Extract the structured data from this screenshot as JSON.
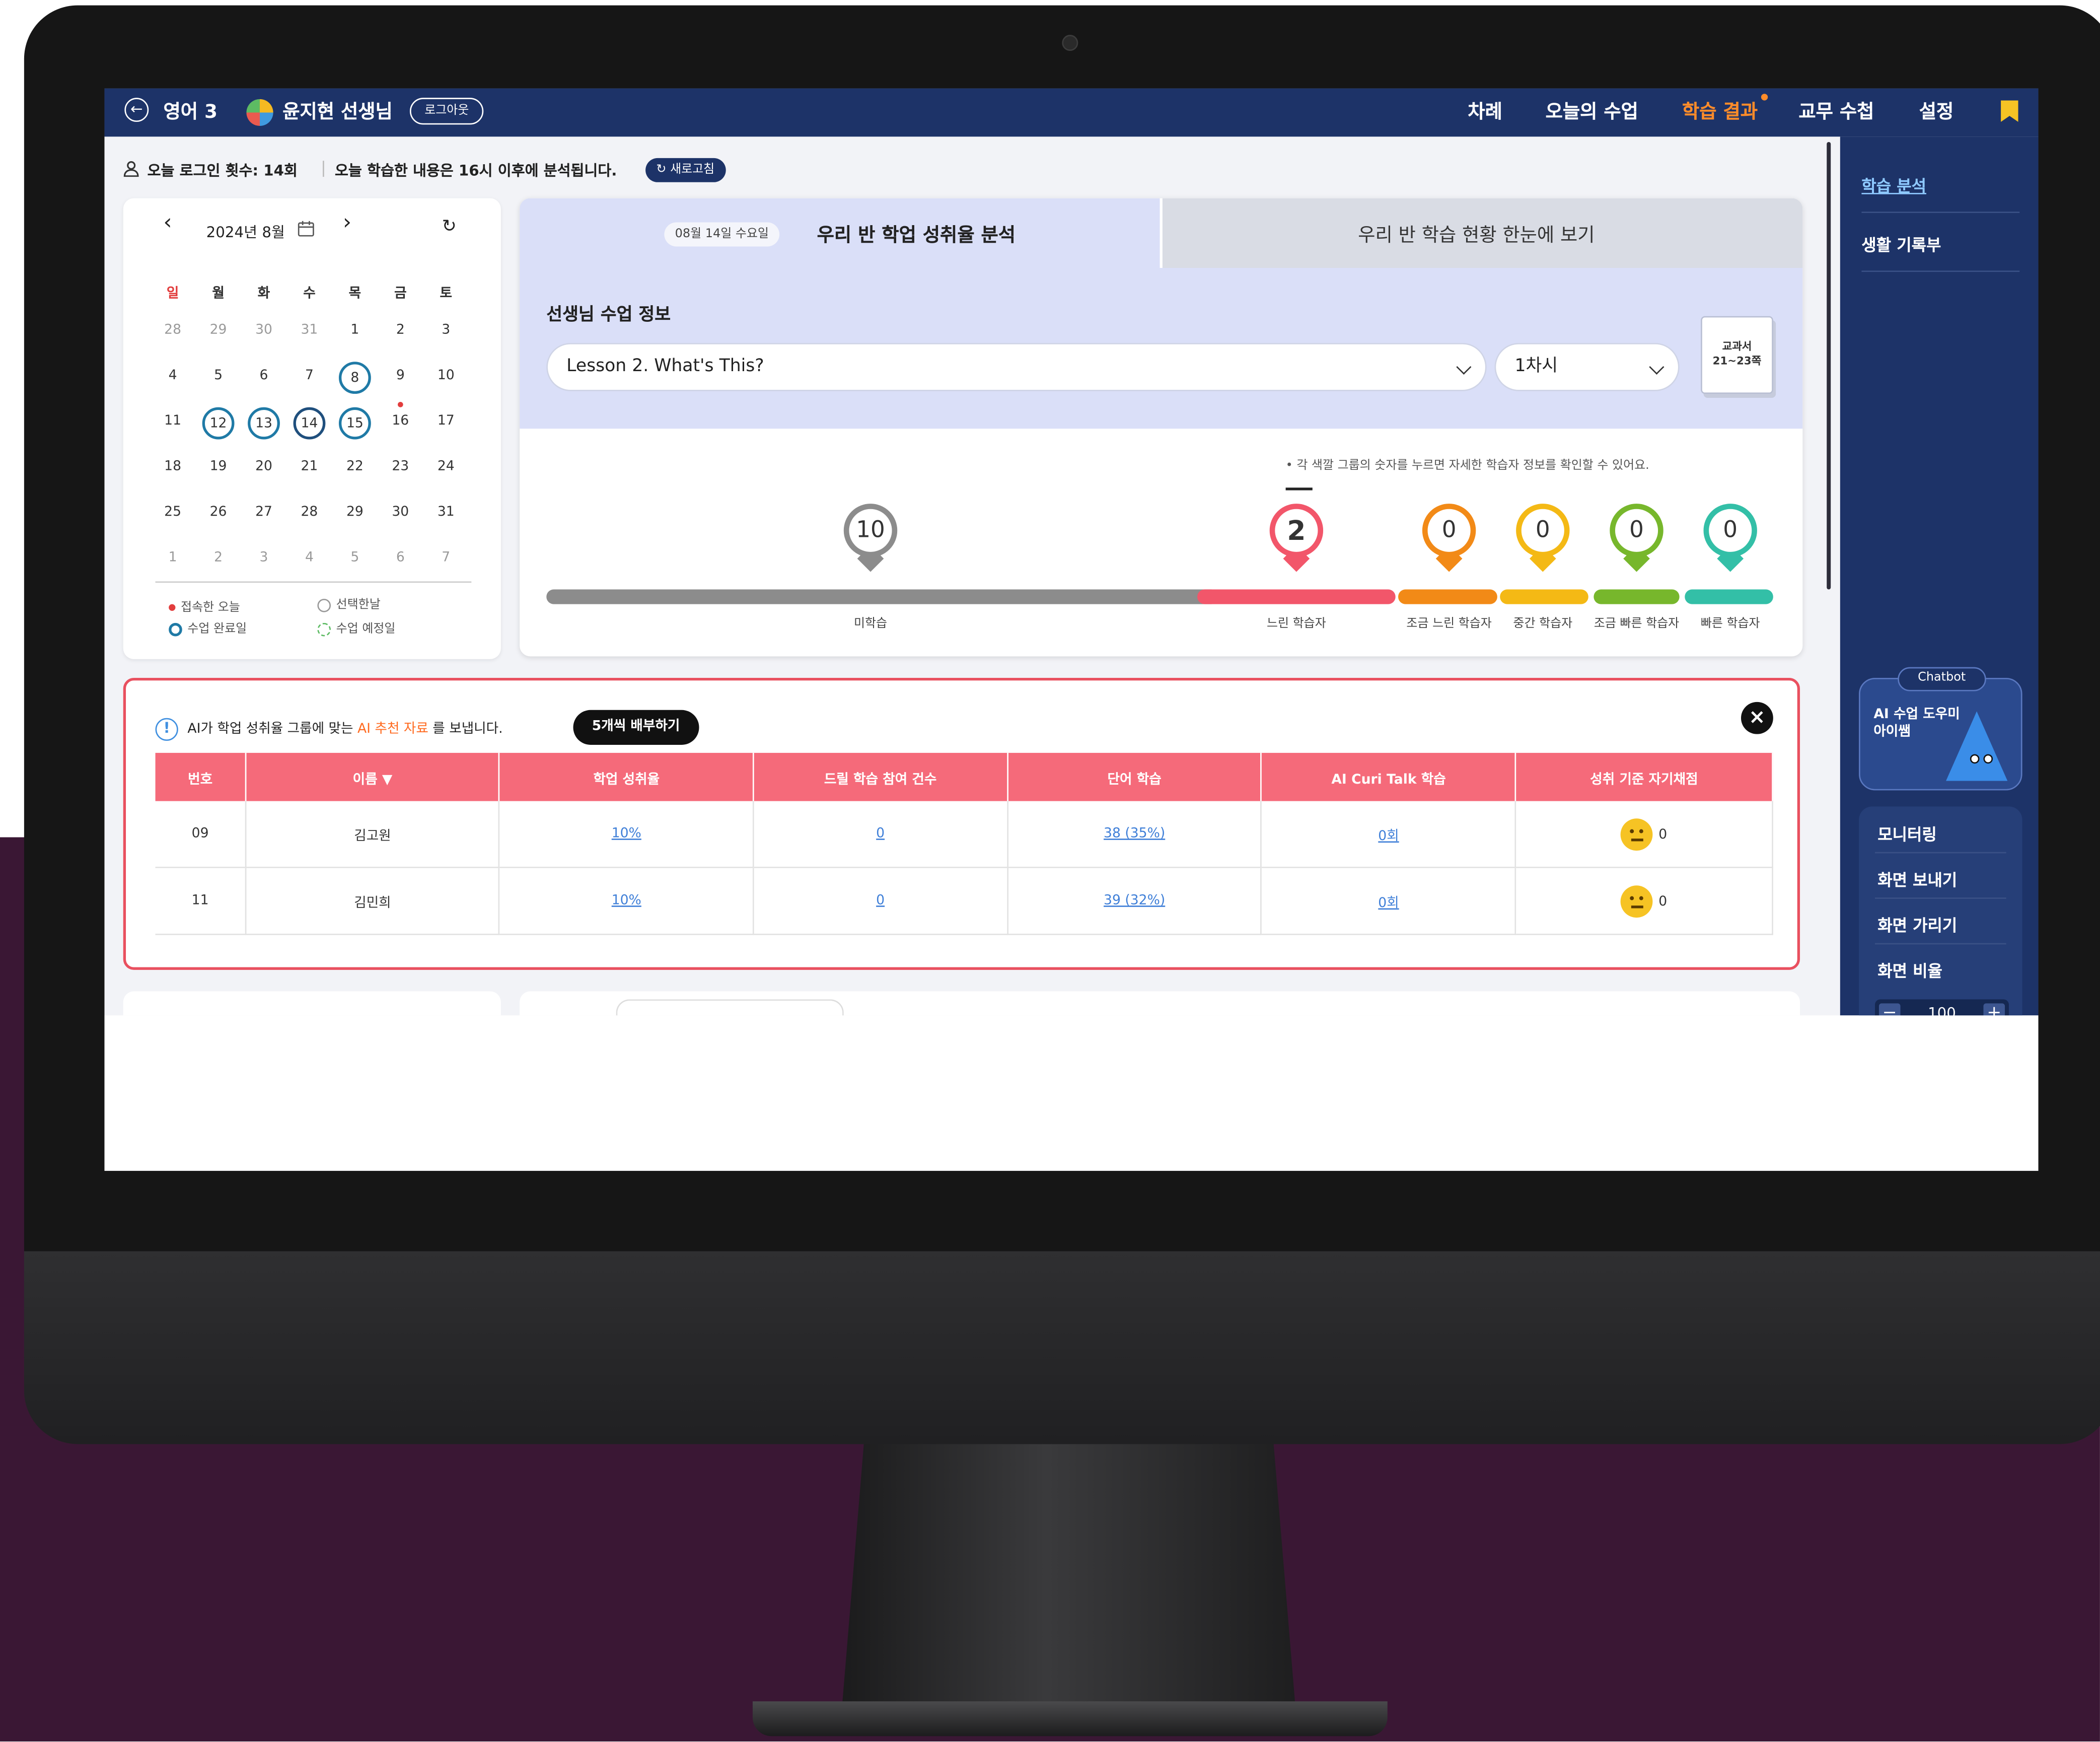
{
  "topbar": {
    "subject": "영어 3",
    "teacher": "윤지현 선생님",
    "logout": "로그아웃",
    "nav": [
      "차례",
      "오늘의 수업",
      "학습 결과",
      "교무 수첩",
      "설정"
    ]
  },
  "infobar": {
    "login_count": "오늘 로그인 횟수: 14회",
    "analysis_note": "오늘 학습한 내용은 16시 이후에 분석됩니다.",
    "refresh": "새로고침"
  },
  "calendar": {
    "month": "2024년 8월",
    "weekdays": [
      "일",
      "월",
      "화",
      "수",
      "목",
      "금",
      "토"
    ],
    "weeks": [
      [
        "28",
        "29",
        "30",
        "31",
        "1",
        "2",
        "3"
      ],
      [
        "4",
        "5",
        "6",
        "7",
        "8",
        "9",
        "10"
      ],
      [
        "11",
        "12",
        "13",
        "14",
        "15",
        "16",
        "17"
      ],
      [
        "18",
        "19",
        "20",
        "21",
        "22",
        "23",
        "24"
      ],
      [
        "25",
        "26",
        "27",
        "28",
        "29",
        "30",
        "31"
      ],
      [
        "1",
        "2",
        "3",
        "4",
        "5",
        "6",
        "7"
      ]
    ],
    "legend": [
      "접속한 오늘",
      "선택한날",
      "수업 완료일",
      "수업 예정일"
    ]
  },
  "analysis": {
    "date_chip": "08월 14일 수요일",
    "tab_active": "우리 반 학업 성취율 분석",
    "tab_inactive": "우리 반 학습 현황 한눈에 보기",
    "lesson_info_title": "선생님 수업 정보",
    "lesson_select": "Lesson 2. What's This?",
    "period_select": "1차시",
    "textbook_line1": "교과서",
    "textbook_line2": "21~23쪽",
    "hint": "• 각 색깔 그룹의 숫자를 누르면 자세한 학습자 정보를 확인할 수 있어요.",
    "groups": [
      {
        "label": "미학습",
        "count": "10",
        "color": "#8c8c8c"
      },
      {
        "label": "느린 학습자",
        "count": "2",
        "color": "#f2566a"
      },
      {
        "label": "조금 느린 학습자",
        "count": "0",
        "color": "#f28a17"
      },
      {
        "label": "중간 학습자",
        "count": "0",
        "color": "#f4b915"
      },
      {
        "label": "조금 빠른 학습자",
        "count": "0",
        "color": "#77b72c"
      },
      {
        "label": "빠른 학습자",
        "count": "0",
        "color": "#33bfa7"
      }
    ]
  },
  "recommendation": {
    "text_before": "AI가 학업 성취율 그룹에 맞는",
    "text_highlight": "AI 추천 자료",
    "text_after": "를 보냅니다.",
    "send_button": "5개씩 배부하기",
    "columns": [
      "번호",
      "이름",
      "학업 성취율",
      "드릴 학습 참여 건수",
      "단어 학습",
      "AI Curi Talk 학습",
      "성취 기준 자기채점"
    ],
    "rows": [
      {
        "no": "09",
        "name": "김고원",
        "achievement": "10%",
        "drill": "0",
        "words": "38 (35%)",
        "curitalk": "0회",
        "self_score": "0"
      },
      {
        "no": "11",
        "name": "김민희",
        "achievement": "10%",
        "drill": "0",
        "words": "39 (32%)",
        "curitalk": "0회",
        "self_score": "0"
      }
    ]
  },
  "sidebar": {
    "items": [
      "학습 분석",
      "생활 기록부"
    ],
    "chatbot_tag": "Chatbot",
    "chatbot_text": "AI 수업 도우미 아이쌤",
    "tools": [
      "모니터링",
      "화면 보내기",
      "화면 가리기",
      "화면 비율"
    ],
    "zoom_value": "100"
  },
  "colors": {
    "navy": "#1d3368",
    "accent_orange": "#ff8c2a",
    "table_header": "#f56a7a",
    "plum_background": "#3a1734"
  }
}
